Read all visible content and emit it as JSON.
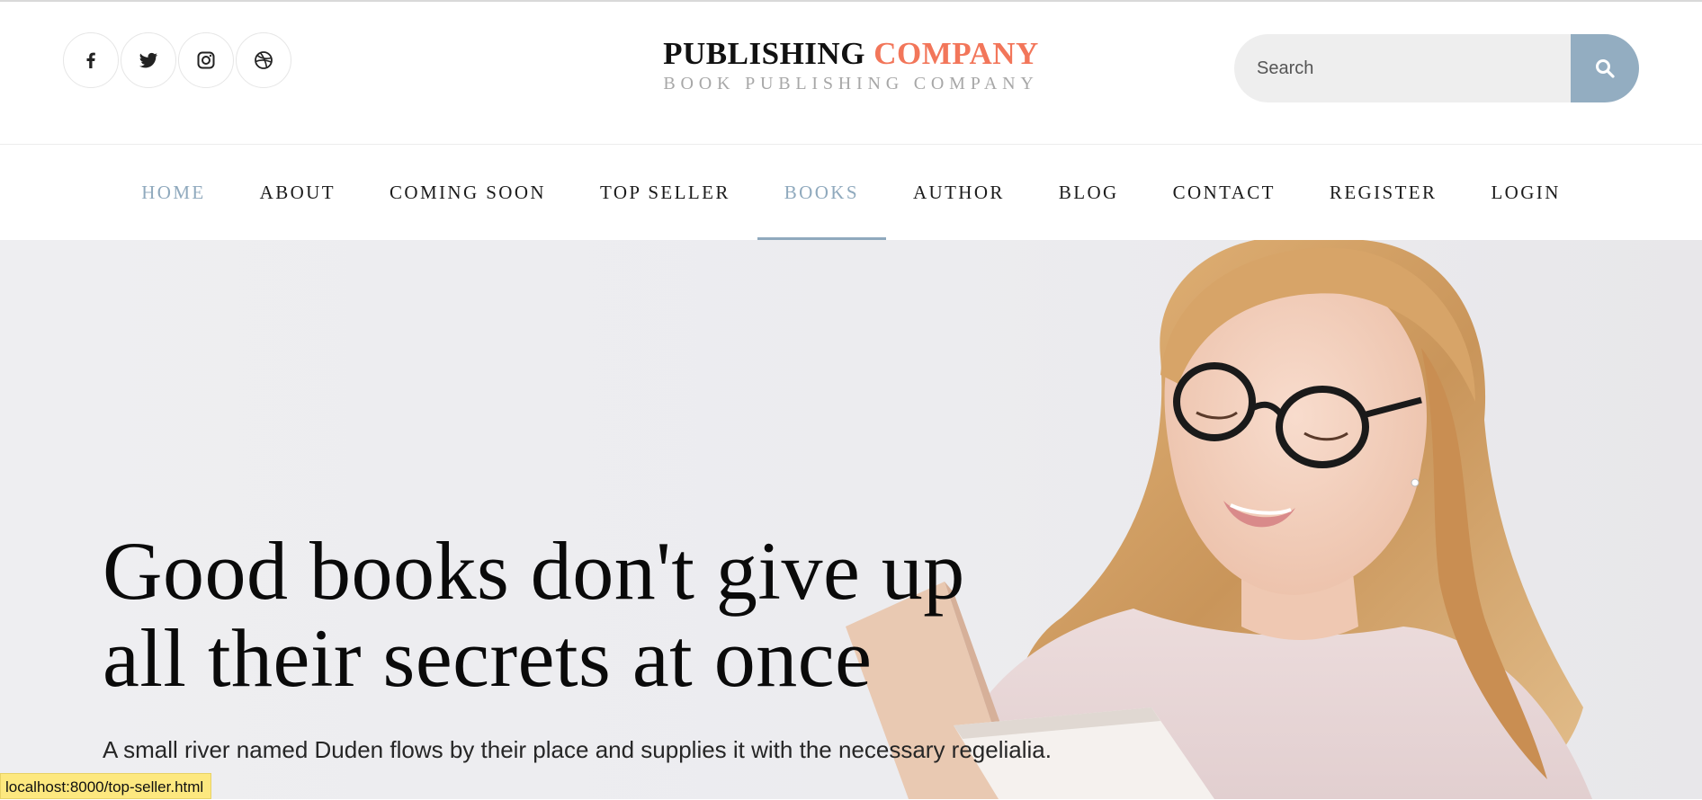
{
  "header": {
    "socials": [
      {
        "icon": "facebook-icon",
        "name": "Facebook"
      },
      {
        "icon": "twitter-icon",
        "name": "Twitter"
      },
      {
        "icon": "instagram-icon",
        "name": "Instagram"
      },
      {
        "icon": "dribbble-icon",
        "name": "Dribbble"
      }
    ],
    "logo": {
      "main_dark": "PUBLISHING",
      "main_accent": "COMPANY",
      "tagline": "BOOK PUBLISHING COMPANY"
    },
    "search": {
      "placeholder": "Search",
      "button_icon": "search-icon"
    }
  },
  "nav": {
    "items": [
      {
        "label": "HOME"
      },
      {
        "label": "ABOUT"
      },
      {
        "label": "COMING SOON"
      },
      {
        "label": "TOP SELLER"
      },
      {
        "label": "BOOKS"
      },
      {
        "label": "AUTHOR"
      },
      {
        "label": "BLOG"
      },
      {
        "label": "CONTACT"
      },
      {
        "label": "REGISTER"
      },
      {
        "label": "LOGIN"
      }
    ]
  },
  "hero": {
    "title_line1": "Good books don't give up",
    "title_line2": "all their secrets at once",
    "subtitle": "A small river named Duden flows by their place and supplies it with the necessary regelialia."
  },
  "status_bar": {
    "url": "localhost:8000/top-seller.html"
  },
  "colors": {
    "accent": "#f2765a",
    "nav_highlight": "#8fa9bd",
    "search_button": "#93adc1",
    "status_bar": "#fde87f"
  }
}
